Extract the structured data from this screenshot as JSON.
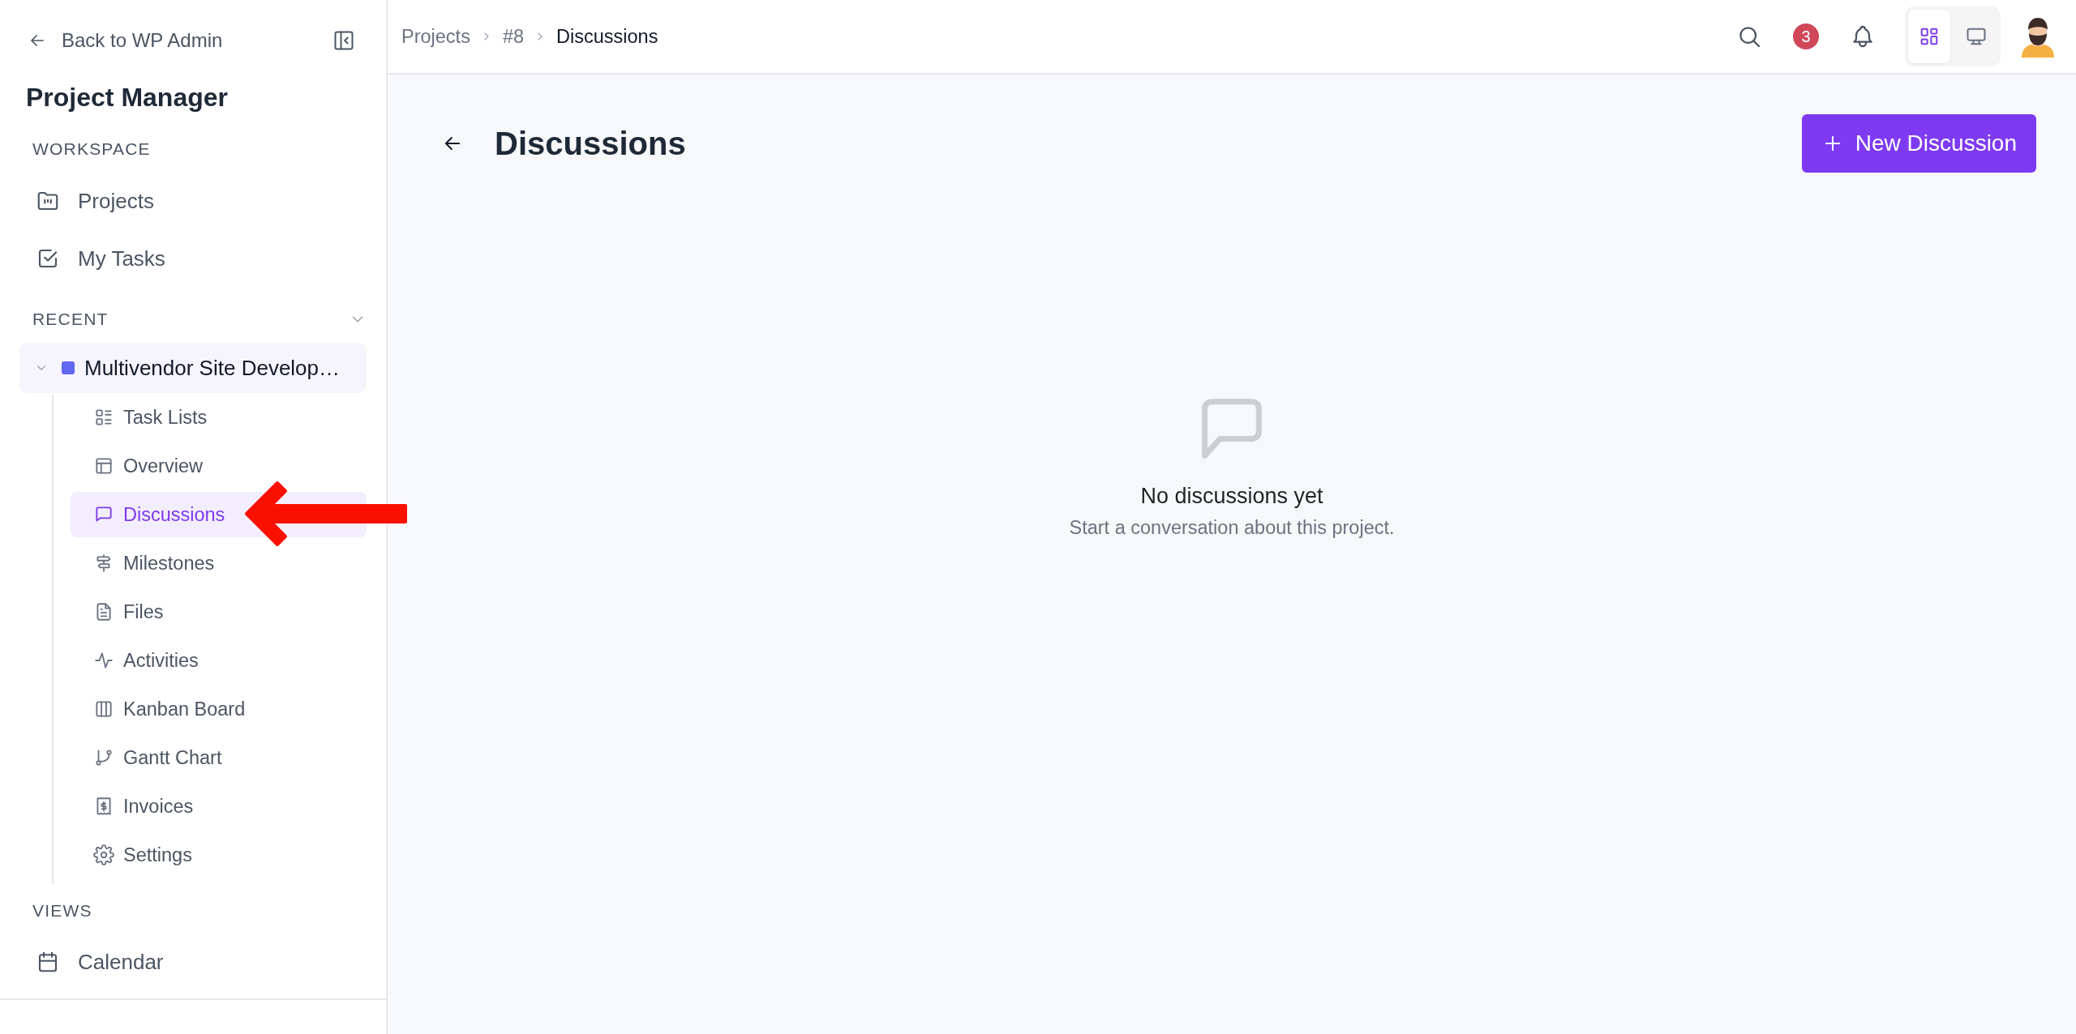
{
  "sidebar": {
    "back_link": "Back to WP Admin",
    "app_title": "Project Manager",
    "workspace": {
      "heading": "WORKSPACE",
      "items": [
        {
          "label": "Projects"
        },
        {
          "label": "My Tasks"
        }
      ]
    },
    "recent": {
      "heading": "RECENT",
      "expanded": true,
      "project": {
        "name": "Multivendor Site Develop…",
        "color": "#6366f1",
        "expanded": true,
        "children": [
          {
            "label": "Task Lists",
            "selected": false
          },
          {
            "label": "Overview",
            "selected": false
          },
          {
            "label": "Discussions",
            "selected": true
          },
          {
            "label": "Milestones",
            "selected": false
          },
          {
            "label": "Files",
            "selected": false
          },
          {
            "label": "Activities",
            "selected": false
          },
          {
            "label": "Kanban Board",
            "selected": false
          },
          {
            "label": "Gantt Chart",
            "selected": false
          },
          {
            "label": "Invoices",
            "selected": false
          },
          {
            "label": "Settings",
            "selected": false
          }
        ]
      }
    },
    "views": {
      "heading": "VIEWS",
      "items": [
        {
          "label": "Calendar"
        }
      ]
    }
  },
  "topbar": {
    "breadcrumb": [
      {
        "label": "Projects",
        "current": false
      },
      {
        "label": "#8",
        "current": false
      },
      {
        "label": "Discussions",
        "current": true
      }
    ],
    "notification_count": "3",
    "view_toggle": [
      {
        "selected": true
      },
      {
        "selected": false
      }
    ]
  },
  "page": {
    "title": "Discussions",
    "primary_button": "New Discussion",
    "empty_state": {
      "title": "No discussions yet",
      "message": "Start a conversation about this project."
    }
  }
}
